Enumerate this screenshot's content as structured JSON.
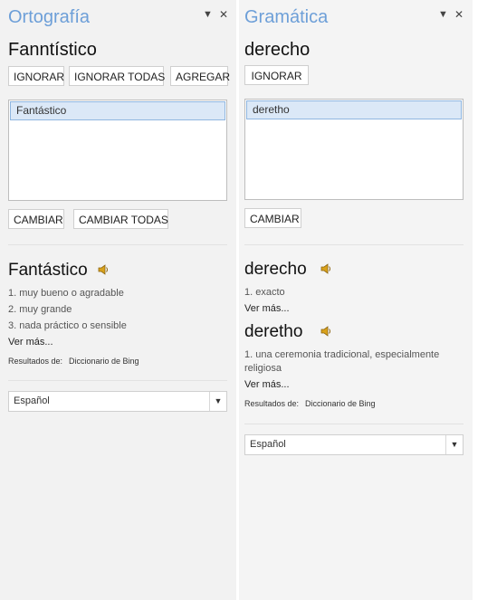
{
  "spelling": {
    "title": "Ortografía",
    "word": "Fanntístico",
    "ignore": "IGNORAR",
    "ignore_all": "IGNORAR TODAS",
    "add": "AGREGAR",
    "suggestion": "Fantástico",
    "change": "CAMBIAR",
    "change_all": "CAMBIAR TODAS",
    "dict_word": "Fantástico",
    "defs": [
      "1. muy bueno o agradable",
      "2. muy grande",
      "3. nada práctico o sensible"
    ],
    "more": "Ver más...",
    "results_label": "Resultados de:",
    "results_source": "Diccionario de Bing",
    "language": "Español"
  },
  "grammar": {
    "title": "Gramática",
    "word": "derecho",
    "ignore": "IGNORAR",
    "suggestion": "deretho",
    "change": "CAMBIAR",
    "dict_word1": "derecho",
    "def1": "1. exacto",
    "more1": "Ver más...",
    "dict_word2": "deretho",
    "def2": "1. una ceremonia tradicional, especialmente religiosa",
    "more2": "Ver más...",
    "results_label": "Resultados de:",
    "results_source": "Diccionario de Bing",
    "language": "Español"
  },
  "header_controls": {
    "dropdown": "▼",
    "close": "✕"
  }
}
